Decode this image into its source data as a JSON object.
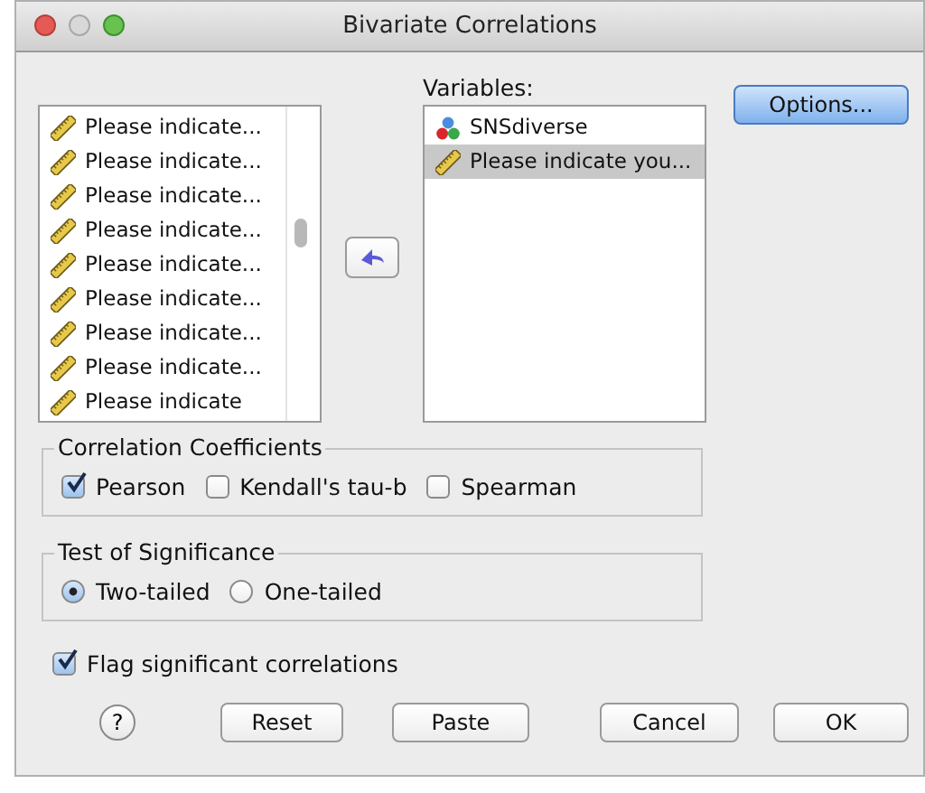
{
  "window": {
    "title": "Bivariate Correlations"
  },
  "source_list": {
    "items": [
      {
        "label": "Please indicate...",
        "kind": "scale"
      },
      {
        "label": "Please indicate...",
        "kind": "scale"
      },
      {
        "label": "Please indicate...",
        "kind": "scale"
      },
      {
        "label": "Please indicate...",
        "kind": "scale"
      },
      {
        "label": "Please indicate...",
        "kind": "scale"
      },
      {
        "label": "Please indicate...",
        "kind": "scale"
      },
      {
        "label": "Please indicate...",
        "kind": "scale"
      },
      {
        "label": "Please indicate...",
        "kind": "scale"
      },
      {
        "label": "Please indicate",
        "kind": "scale"
      }
    ]
  },
  "variables": {
    "label": "Variables:",
    "items": [
      {
        "label": "SNSdiverse",
        "kind": "nominal",
        "selected": false
      },
      {
        "label": "Please indicate you...",
        "kind": "scale",
        "selected": true
      }
    ]
  },
  "options_button": "Options...",
  "correlation_coefficients": {
    "title": "Correlation Coefficients",
    "options": [
      {
        "label": "Pearson",
        "checked": true
      },
      {
        "label": "Kendall's tau-b",
        "checked": false
      },
      {
        "label": "Spearman",
        "checked": false
      }
    ]
  },
  "test_of_significance": {
    "title": "Test of Significance",
    "options": [
      {
        "label": "Two-tailed",
        "selected": true
      },
      {
        "label": "One-tailed",
        "selected": false
      }
    ]
  },
  "flag_significant": {
    "label": "Flag significant correlations",
    "checked": true
  },
  "help_button": "?",
  "buttons": [
    "Reset",
    "Paste",
    "Cancel",
    "OK"
  ]
}
